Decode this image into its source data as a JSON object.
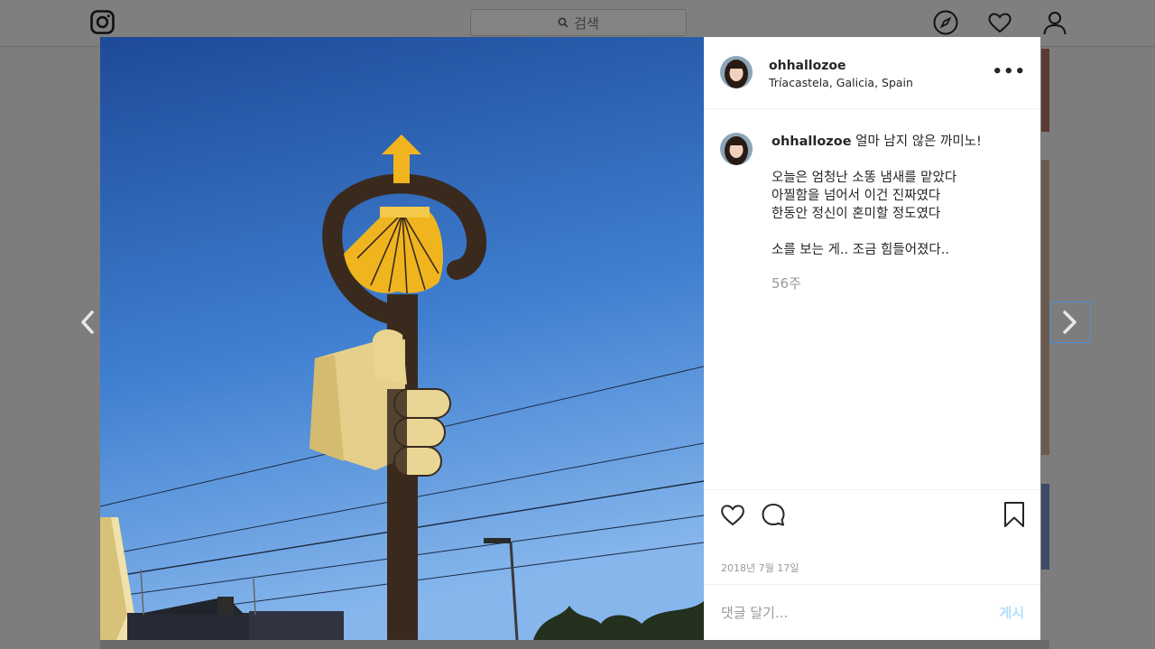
{
  "header": {
    "search_placeholder": "검색"
  },
  "post": {
    "username": "ohhallozoe",
    "location": "Tríacastela, Galicia, Spain",
    "caption_user": "ohhallozoe",
    "caption_text": " 얼마 남지 않은 까미노!\n\n오늘은 엄청난 소똥 냄새를 맡았다\n아찔함을 넘어서 이건 진짜였다\n한동안 정신이 혼미할 정도였다\n\n소를 보는 게.. 조금 힘들어졌다..",
    "age": "56주",
    "date": "2018년 7월 17일",
    "comment_placeholder": "댓글 달기...",
    "post_label": "게시"
  },
  "icons": {
    "logo": "instagram-icon",
    "explore": "compass-icon",
    "activity": "heart-icon",
    "profile": "user-icon",
    "more": "more-icon",
    "like": "heart-icon",
    "comment": "comment-icon",
    "save": "bookmark-icon",
    "prev": "chevron-left-icon",
    "next": "chevron-right-icon"
  },
  "colors": {
    "link": "#b2dffc",
    "sky_top": "#1f4f9e",
    "sky_bottom": "#7fb0e8",
    "shell": "#f2b41e",
    "post": "#3a2a1d"
  }
}
